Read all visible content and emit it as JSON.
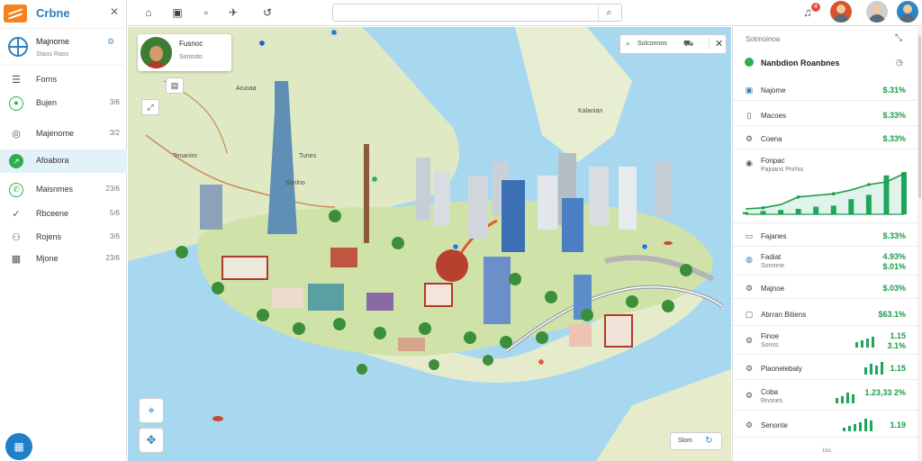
{
  "brand": {
    "name": "Crbne"
  },
  "account": {
    "title": "Majnome",
    "subtitle": "Staos Raos"
  },
  "nav": [
    {
      "label": "Forns",
      "value": "",
      "icon": "list-icon",
      "glyph": "☰"
    },
    {
      "label": "Bujen",
      "value": "3/6",
      "icon": "dot-icon",
      "glyph": "●"
    },
    {
      "label": "Majenome",
      "value": "3/2",
      "icon": "globe-icon",
      "glyph": "◎"
    },
    {
      "label": "Afoabora",
      "value": "",
      "icon": "route-icon",
      "glyph": "↗"
    },
    {
      "label": "Maisnmes",
      "value": "23/6",
      "icon": "phone-icon",
      "glyph": "✆"
    },
    {
      "label": "Rbceene",
      "value": "5/6",
      "icon": "check-icon",
      "glyph": "✓"
    },
    {
      "label": "Rojens",
      "value": "3/6",
      "icon": "people-icon",
      "glyph": "⚇"
    },
    {
      "label": "Mjone",
      "value": "23/6",
      "icon": "grid-icon",
      "glyph": "▦"
    }
  ],
  "fab_icon": "building-icon",
  "toolbar": {
    "search_placeholder": "",
    "notification_count": "4",
    "buttons": [
      {
        "icon": "home-icon",
        "glyph": "⌂"
      },
      {
        "icon": "image-icon",
        "glyph": "▣"
      },
      {
        "icon": "layers-icon",
        "glyph": "▫"
      },
      {
        "icon": "plane-icon",
        "glyph": "✈"
      },
      {
        "icon": "history-icon",
        "glyph": "↺"
      }
    ]
  },
  "map": {
    "card": {
      "title": "Fusnoc",
      "subtitle": "Sonosto"
    },
    "search_label": "Solconnos",
    "zoom_label": "Slom",
    "labels": [
      {
        "text": "Aruoaa"
      },
      {
        "text": "Tenaniro"
      },
      {
        "text": "Tunes"
      },
      {
        "text": "Sonlno"
      },
      {
        "text": "Kalanian"
      }
    ]
  },
  "panel": {
    "header": "Sotmoinoa",
    "title": "Nanbdion Roanbnes",
    "rows": [
      {
        "label": "Najome",
        "value": "$.31%",
        "icon": "chart-icon"
      },
      {
        "label": "Macoes",
        "value": "$.33%",
        "icon": "file-icon"
      },
      {
        "label": "Coena",
        "value": "$.33%",
        "icon": "settings-icon"
      },
      {
        "label": "Fonpac",
        "sub": "Pajoans Pnrhis",
        "value": "",
        "icon": "location-icon"
      },
      {
        "label": "Fajanes",
        "value": "$.33%",
        "icon": "doc-icon"
      },
      {
        "label": "Fadiat",
        "sub": "Sonmne",
        "value": "4.93%",
        "value2": "$.01%",
        "icon": "pin-icon"
      },
      {
        "label": "Majnoe",
        "value": "$.03%",
        "icon": "gear-icon"
      },
      {
        "label": "Abrran Bitiens",
        "value": "$63.1%",
        "icon": "box-icon"
      },
      {
        "label": "Finoe",
        "sub": "Sonss",
        "value": "1.15",
        "value2": "3.1%",
        "icon": "gear-icon"
      },
      {
        "label": "Plaonelebaly",
        "value": "1.15",
        "icon": "gear-icon"
      },
      {
        "label": "Coba",
        "sub": "Rnones",
        "value": "1.23,33 2%",
        "icon": "settings-icon"
      },
      {
        "label": "Senonte",
        "value": "1.19",
        "icon": "settings-icon"
      }
    ],
    "footer": "1bo."
  },
  "chart_data": {
    "type": "area",
    "x": [
      1,
      2,
      3,
      4,
      5,
      6,
      7,
      8,
      9,
      10
    ],
    "series": [
      {
        "values": [
          10,
          12,
          18,
          32,
          35,
          38,
          45,
          55,
          60,
          75
        ]
      }
    ],
    "bars": [
      4,
      6,
      8,
      10,
      14,
      16,
      28,
      36,
      72,
      78
    ],
    "colors": {
      "line": "#1e9a4a",
      "fill": "#d6f0e6",
      "bar": "#1ea65a"
    }
  }
}
